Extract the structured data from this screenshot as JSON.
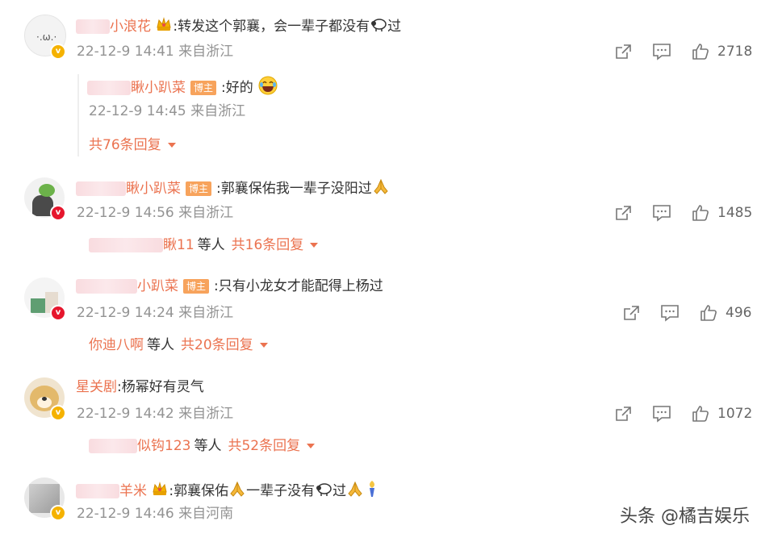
{
  "comments": [
    {
      "user_suffix": "小浪花",
      "has_crown": true,
      "text": ":转发这个郭襄，会一辈子都没有",
      "text_tail": "过",
      "time": "22-12-9 14:41 来自浙江",
      "likes": "2718",
      "sub_reply": {
        "user_suffix": "瞅小趴菜",
        "tag": "博主",
        "text": ":好的",
        "time": "22-12-9 14:45 来自浙江",
        "more": "共76条回复"
      }
    },
    {
      "user_suffix": "瞅小趴菜",
      "tag": "博主",
      "text": ":郭襄保佑我一辈子没阳过",
      "time": "22-12-9 14:56 来自浙江",
      "likes": "1485",
      "reply_user": "瞅11",
      "others": "等人",
      "more": "共16条回复"
    },
    {
      "user_suffix": "小趴菜",
      "tag": "博主",
      "text": ":只有小龙女才能配得上杨过",
      "time": "22-12-9 14:24 来自浙江",
      "likes": "496",
      "reply_user": "你迪八啊",
      "others": "等人",
      "more": "共20条回复"
    },
    {
      "user_suffix": "星关剧",
      "text": ":杨幂好有灵气",
      "time": "22-12-9 14:42 来自浙江",
      "likes": "1072",
      "reply_user": "似钩123",
      "others": "等人",
      "more": "共52条回复"
    },
    {
      "user_suffix": "羊米",
      "has_crown": true,
      "text": ":郭襄保佑",
      "text_mid": "一辈子没有",
      "text_tail": "过",
      "time": "22-12-9 14:46 来自河南"
    }
  ],
  "watermark": "头条 @橘吉娱乐",
  "colors": {
    "username": "#eb7350",
    "meta": "#939393",
    "tag_bg": "#f7a35c",
    "badge_gold": "#f5b200",
    "badge_red": "#e6162d"
  },
  "icons": [
    "share-icon",
    "comment-icon",
    "like-icon",
    "crown-icon",
    "sheep-icon",
    "pray-icon",
    "laugh-emoji-icon",
    "caret-down-icon",
    "verified-badge-icon"
  ]
}
